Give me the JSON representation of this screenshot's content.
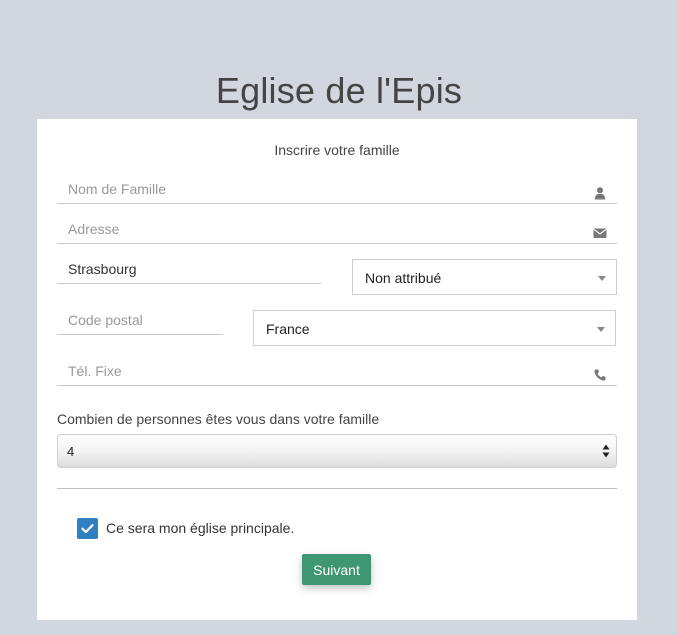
{
  "page": {
    "title": "Eglise de l'Epis"
  },
  "form": {
    "subtitle": "Inscrire votre famille",
    "family_name": {
      "placeholder": "Nom de Famille",
      "value": "",
      "icon": "user-icon"
    },
    "address": {
      "placeholder": "Adresse",
      "value": "",
      "icon": "envelope-icon"
    },
    "city": {
      "value": "Strasbourg"
    },
    "region_select": {
      "selected": "Non attribué"
    },
    "postal_code": {
      "placeholder": "Code postal",
      "value": ""
    },
    "country_select": {
      "selected": "France"
    },
    "phone": {
      "placeholder": "Tél. Fixe",
      "value": "",
      "icon": "phone-icon"
    },
    "family_size_question": "Combien de personnes êtes vous dans votre famille",
    "family_size_select": {
      "selected": "4"
    },
    "main_church_checkbox": {
      "label": "Ce sera mon église principale.",
      "checked": true
    },
    "next_button": "Suivant"
  },
  "colors": {
    "background": "#d2d6de",
    "checkbox": "#2f7fc1",
    "button": "#3e9672"
  }
}
